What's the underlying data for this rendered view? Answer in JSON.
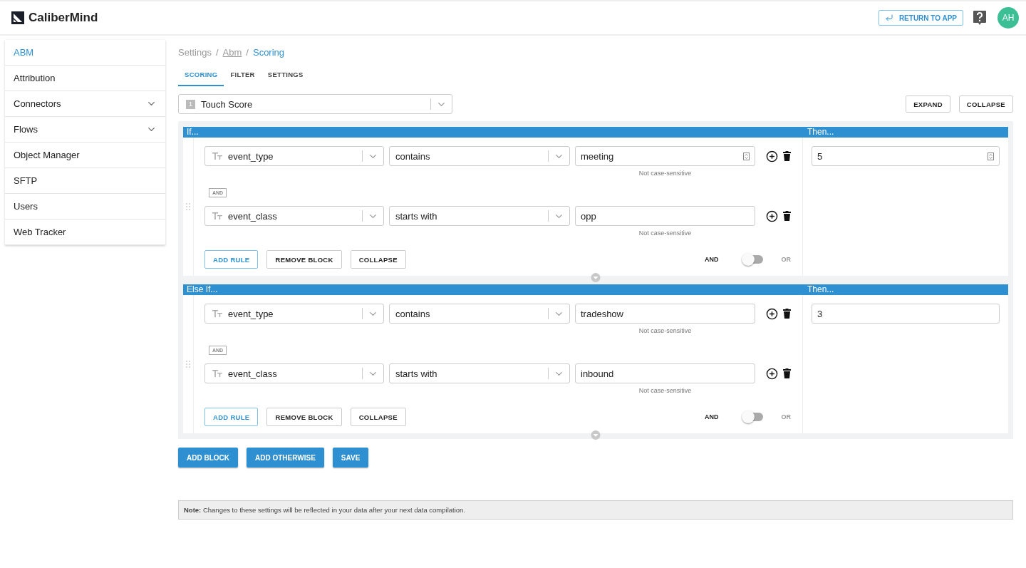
{
  "header": {
    "brand": "CaliberMind",
    "return_button": "RETURN TO APP",
    "avatar": "AH"
  },
  "sidebar": {
    "items": [
      {
        "label": "ABM",
        "selected": true,
        "expandable": false
      },
      {
        "label": "Attribution",
        "selected": false,
        "expandable": false
      },
      {
        "label": "Connectors",
        "selected": false,
        "expandable": true
      },
      {
        "label": "Flows",
        "selected": false,
        "expandable": true
      },
      {
        "label": "Object Manager",
        "selected": false,
        "expandable": false
      },
      {
        "label": "SFTP",
        "selected": false,
        "expandable": false
      },
      {
        "label": "Users",
        "selected": false,
        "expandable": false
      },
      {
        "label": "Web Tracker",
        "selected": false,
        "expandable": false
      }
    ]
  },
  "breadcrumb": [
    {
      "label": "Settings",
      "kind": "plain"
    },
    {
      "separator": "/",
      "label": "Abm",
      "kind": "link"
    },
    {
      "separator": "/",
      "label": "Scoring",
      "kind": "current"
    }
  ],
  "tabs": [
    {
      "label": "SCORING",
      "selected": true
    },
    {
      "label": "FILTER",
      "selected": false
    },
    {
      "label": "SETTINGS",
      "selected": false
    }
  ],
  "score_select": {
    "index": "1",
    "value": "Touch Score"
  },
  "expand_button": "EXPAND",
  "collapse_button": "COLLAPSE",
  "blocks": [
    {
      "label": "If...",
      "then_label": "Then...",
      "then_value": "5",
      "then_picker": true,
      "connector": "AND",
      "or_selected": false,
      "and_label": "AND",
      "or_label": "OR",
      "rules": [
        {
          "field": "event_type",
          "operator": "contains",
          "value": "meeting",
          "picker": true,
          "hint": "Not case-sensitive"
        },
        {
          "field": "event_class",
          "operator": "starts with",
          "value": "opp",
          "picker": false,
          "hint": "Not case-sensitive"
        }
      ],
      "buttons": [
        "ADD RULE",
        "REMOVE BLOCK",
        "COLLAPSE"
      ]
    },
    {
      "label": "Else If...",
      "then_label": "Then...",
      "then_value": "3",
      "then_picker": false,
      "connector": "AND",
      "or_selected": false,
      "and_label": "AND",
      "or_label": "OR",
      "rules": [
        {
          "field": "event_type",
          "operator": "contains",
          "value": "tradeshow",
          "picker": false,
          "hint": "Not case-sensitive"
        },
        {
          "field": "event_class",
          "operator": "starts with",
          "value": "inbound",
          "picker": false,
          "hint": "Not case-sensitive"
        }
      ],
      "buttons": [
        "ADD RULE",
        "REMOVE BLOCK",
        "COLLAPSE"
      ]
    }
  ],
  "actions": [
    "ADD BLOCK",
    "ADD OTHERWISE",
    "SAVE"
  ],
  "note": "**Note:** Changes to these settings will be reflected in your data after your next data compilation."
}
